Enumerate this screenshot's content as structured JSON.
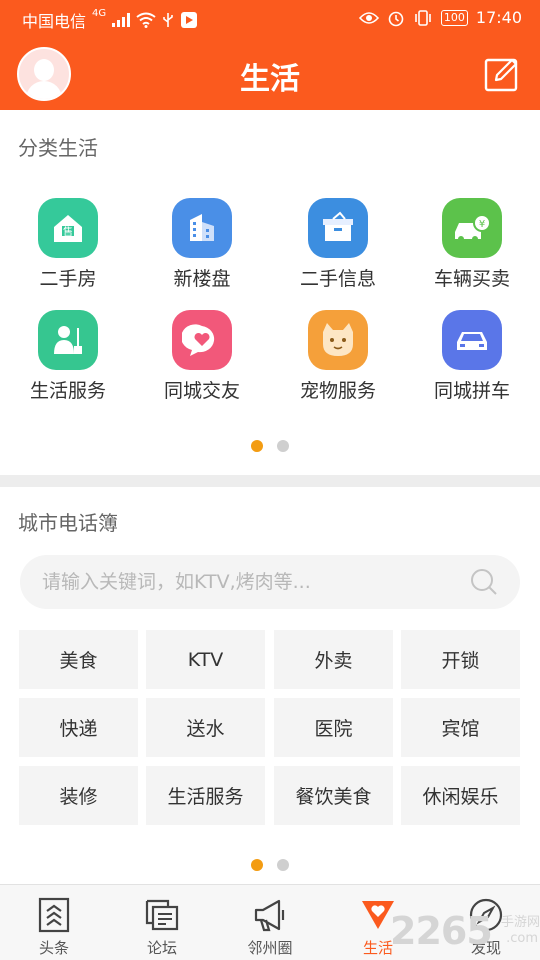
{
  "status_bar": {
    "carrier": "中国电信",
    "network": "4G",
    "battery": "100",
    "time": "17:40"
  },
  "header": {
    "title": "生活"
  },
  "categories": {
    "title": "分类生活",
    "items": [
      {
        "label": "二手房",
        "icon": "house-icon",
        "color": "#35c99a"
      },
      {
        "label": "新楼盘",
        "icon": "building-icon",
        "color": "#4a8fe7"
      },
      {
        "label": "二手信息",
        "icon": "box-icon",
        "color": "#3c8ee0"
      },
      {
        "label": "车辆买卖",
        "icon": "car-sale-icon",
        "color": "#5cc24b"
      },
      {
        "label": "生活服务",
        "icon": "cleaner-icon",
        "color": "#36c690"
      },
      {
        "label": "同城交友",
        "icon": "heart-chat-icon",
        "color": "#f2587a"
      },
      {
        "label": "宠物服务",
        "icon": "cat-icon",
        "color": "#f5a03a"
      },
      {
        "label": "同城拼车",
        "icon": "car-icon",
        "color": "#5a76e8"
      }
    ],
    "page_current": 1,
    "page_total": 2
  },
  "phonebook": {
    "title": "城市电话簿",
    "search_placeholder": "请输入关键词，如KTV,烤肉等...",
    "keywords": [
      "美食",
      "KTV",
      "外卖",
      "开锁",
      "快递",
      "送水",
      "医院",
      "宾馆",
      "装修",
      "生活服务",
      "餐饮美食",
      "休闲娱乐"
    ],
    "page_current": 1,
    "page_total": 2
  },
  "bottom_nav": {
    "items": [
      {
        "label": "头条",
        "icon": "headline-icon",
        "active": false
      },
      {
        "label": "论坛",
        "icon": "forum-icon",
        "active": false
      },
      {
        "label": "邻州圈",
        "icon": "megaphone-icon",
        "active": false
      },
      {
        "label": "生活",
        "icon": "heart-badge-icon",
        "active": true
      },
      {
        "label": "发现",
        "icon": "compass-icon",
        "active": false
      }
    ]
  },
  "watermark": {
    "brand": "2265",
    "tagline": "手游网",
    "url": ".com"
  },
  "colors": {
    "brand": "#fb5a1e",
    "dot_active": "#f39c12"
  }
}
